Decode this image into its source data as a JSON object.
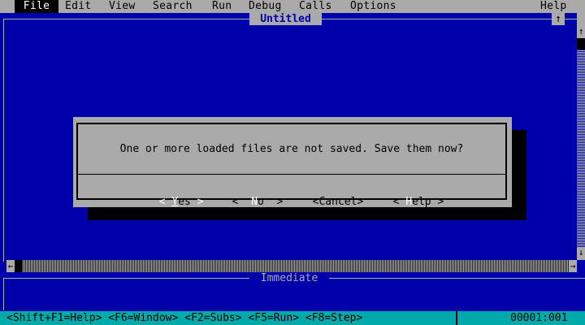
{
  "menubar": {
    "items": [
      "File",
      "Edit",
      "View",
      "Search",
      "Run",
      "Debug",
      "Calls",
      "Options"
    ],
    "help": "Help"
  },
  "editor": {
    "title": "Untitled",
    "maximize_glyph": "↑"
  },
  "scroll": {
    "up": "↑",
    "down": "↓",
    "left": "←",
    "right": "→"
  },
  "immediate": {
    "title": "Immediate"
  },
  "dialog": {
    "message": "One or more loaded files are not saved. Save them now?",
    "buttons": {
      "yes": {
        "open": "<",
        "hotkey": "Y",
        "rest": "es",
        "close": ">"
      },
      "no": {
        "open": "<",
        "hotkey": "N",
        "rest": "o",
        "close": ">"
      },
      "cancel": {
        "label": "<Cancel>"
      },
      "help": {
        "open": "<",
        "hotkey": "H",
        "rest": "elp",
        "close": ">"
      }
    }
  },
  "statusbar": {
    "shortcuts": "<Shift+F1=Help> <F6=Window> <F2=Subs> <F5=Run> <F8=Step>",
    "position": "00001:001"
  },
  "colors": {
    "background": "#0000aa",
    "chrome": "#aaaaaa",
    "statusbar": "#00aaaa"
  }
}
